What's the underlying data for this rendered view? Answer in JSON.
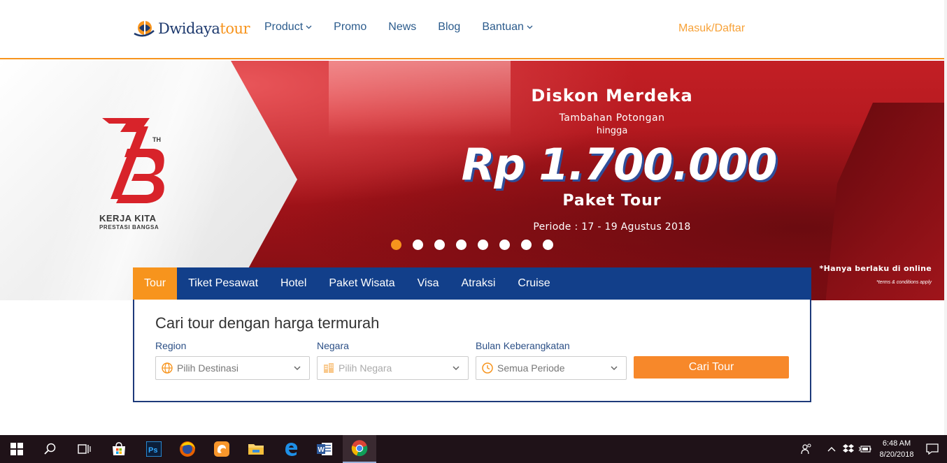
{
  "header": {
    "logo": {
      "brand_main": "Dwidaya",
      "brand_accent": "tour"
    },
    "nav": [
      {
        "label": "Product",
        "has_dropdown": true
      },
      {
        "label": "Promo",
        "has_dropdown": false
      },
      {
        "label": "News",
        "has_dropdown": false
      },
      {
        "label": "Blog",
        "has_dropdown": false
      },
      {
        "label": "Bantuan",
        "has_dropdown": true
      }
    ],
    "login_label": "Masuk/Daftar"
  },
  "banner": {
    "emblem_number": "73",
    "emblem_suffix": "TH",
    "emblem_line1": "KERJA KITA",
    "emblem_line2": "PRESTASI BANGSA",
    "title": "Diskon Merdeka",
    "subtitle": "Tambahan Potongan",
    "subtitle2": "hingga",
    "amount": "Rp 1.700.000",
    "product": "Paket Tour",
    "period": "Periode : 17 - 19 Agustus 2018",
    "note": "*Hanya berlaku di online",
    "terms": "*terms & conditions apply",
    "slide_count": 8,
    "active_slide": 0
  },
  "search": {
    "tabs": [
      "Tour",
      "Tiket Pesawat",
      "Hotel",
      "Paket Wisata",
      "Visa",
      "Atraksi",
      "Cruise"
    ],
    "active_tab": "Tour",
    "heading": "Cari tour dengan harga termurah",
    "region": {
      "label": "Region",
      "value": "Pilih Destinasi"
    },
    "negara": {
      "label": "Negara",
      "value": "Pilih Negara"
    },
    "bulan": {
      "label": "Bulan Keberangkatan",
      "value": "Semua Periode"
    },
    "submit_label": "Cari Tour"
  },
  "taskbar": {
    "time": "6:48 AM",
    "date": "8/20/2018"
  },
  "colors": {
    "primary_blue": "#123f8a",
    "accent_orange": "#f7941d",
    "banner_red": "#b3141a"
  }
}
